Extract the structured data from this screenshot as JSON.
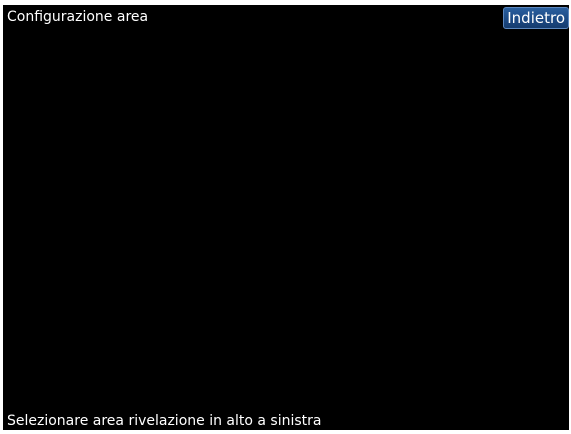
{
  "header": {
    "title": "Configurazione area",
    "back_label": "Indietro"
  },
  "footer": {
    "instruction": "Selezionare area rivelazione in alto a sinistra"
  },
  "colors": {
    "background": "#000000",
    "text": "#ffffff",
    "button_accent": "#1c4a85"
  }
}
